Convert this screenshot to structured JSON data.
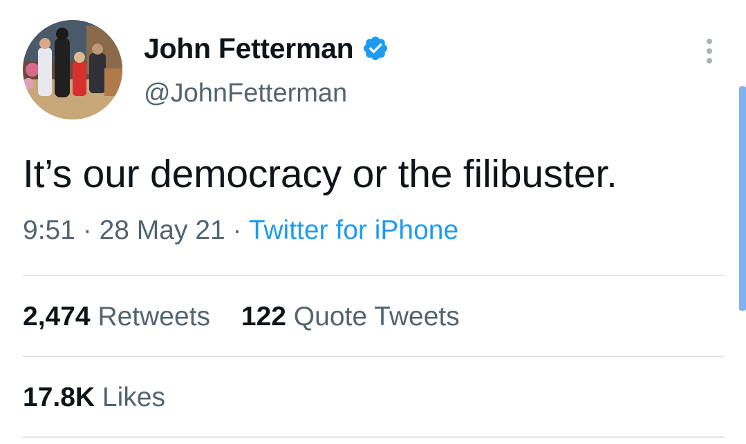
{
  "author": {
    "name": "John Fetterman",
    "handle": "@JohnFetterman"
  },
  "tweet": {
    "text": "It’s our democracy or the filibuster.",
    "time": "9:51",
    "date": "28 May 21",
    "separator": "·",
    "source": "Twitter for iPhone"
  },
  "stats": {
    "retweets_count": "2,474",
    "retweets_label": "Retweets",
    "quotes_count": "122",
    "quotes_label": "Quote Tweets",
    "likes_count": "17.8K",
    "likes_label": "Likes"
  },
  "icons": {
    "verified": "verified-badge-icon",
    "more": "more-vertical-icon"
  },
  "colors": {
    "accent": "#1d9bf0",
    "text": "#0f1419",
    "muted": "#536471",
    "divider": "#e1e6ea"
  }
}
